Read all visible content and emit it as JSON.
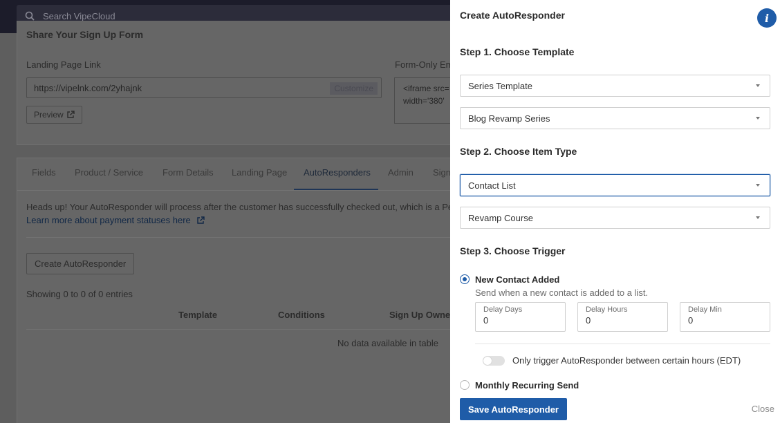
{
  "topbar": {
    "search_placeholder": "Search VipeCloud"
  },
  "share": {
    "title": "Share Your Sign Up Form",
    "landing_label": "Landing Page Link",
    "landing_url": "https://vipelnk.com/2yhajnk",
    "customize_label": "Customize",
    "embed_label": "Form-Only Em",
    "embed_line1": "<iframe src=",
    "embed_line2": "width='380' ",
    "preview_label": "Preview"
  },
  "tabs": [
    {
      "label": "Fields"
    },
    {
      "label": "Product / Service"
    },
    {
      "label": "Form Details"
    },
    {
      "label": "Landing Page"
    },
    {
      "label": "AutoResponders"
    },
    {
      "label": "Admin"
    },
    {
      "label": "Sign"
    }
  ],
  "autoresponders": {
    "headsup": "Heads up! Your AutoResponder will process after the customer has successfully checked out, which is a Pen",
    "learn_more": "Learn more about payment statuses here",
    "create_button": "Create AutoResponder",
    "showing": "Showing 0 to 0 of 0 entries",
    "columns": [
      "Template",
      "Conditions",
      "Sign Up Owner"
    ],
    "empty": "No data available in table"
  },
  "panel": {
    "title": "Create AutoResponder",
    "info_icon": "i",
    "step1": "Step 1. Choose Template",
    "template_type": "Series Template",
    "template_name": "Blog Revamp Series",
    "step2": "Step 2. Choose Item Type",
    "item_type": "Contact List",
    "item_name": "Revamp Course",
    "step3": "Step 3. Choose Trigger",
    "trigger_new": "New Contact Added",
    "trigger_new_desc": "Send when a new contact is added to a list.",
    "delay_days_label": "Delay Days",
    "delay_days": "0",
    "delay_hours_label": "Delay Hours",
    "delay_hours": "0",
    "delay_min_label": "Delay Min",
    "delay_min": "0",
    "hours_toggle_label": "Only trigger AutoResponder between certain hours (EDT)",
    "trigger_monthly": "Monthly Recurring Send",
    "save_label": "Save AutoResponder",
    "close_label": "Close"
  },
  "colors": {
    "accent": "#1f5ca8"
  }
}
